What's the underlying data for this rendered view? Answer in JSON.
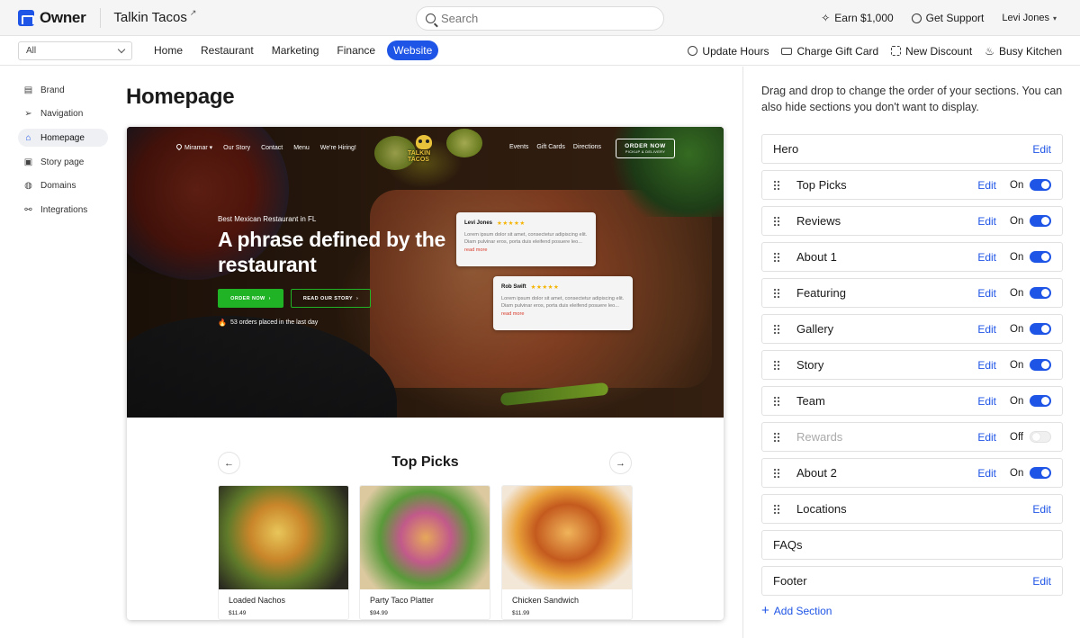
{
  "app": {
    "logo_text": "Owner",
    "restaurant": "Talkin Tacos",
    "restaurant_ext": "↗"
  },
  "search": {
    "placeholder": "Search"
  },
  "top_right": {
    "earn": "Earn $1,000",
    "support": "Get Support",
    "user": "Levi Jones"
  },
  "navbar": {
    "select_value": "All",
    "tabs": [
      {
        "label": "Home"
      },
      {
        "label": "Restaurant"
      },
      {
        "label": "Marketing"
      },
      {
        "label": "Finance"
      },
      {
        "label": "Website",
        "active": true
      }
    ],
    "actions": [
      {
        "label": "Update Hours",
        "icon": "clock-icon"
      },
      {
        "label": "Charge Gift Card",
        "icon": "card-icon"
      },
      {
        "label": "New Discount",
        "icon": "discount-icon"
      },
      {
        "label": "Busy Kitchen",
        "icon": "kitchen-icon"
      }
    ]
  },
  "sidebar": {
    "items": [
      {
        "label": "Brand",
        "icon": "brand-icon"
      },
      {
        "label": "Navigation",
        "icon": "navigation-icon"
      },
      {
        "label": "Homepage",
        "icon": "home-icon",
        "active": true
      },
      {
        "label": "Story page",
        "icon": "story-icon"
      },
      {
        "label": "Domains",
        "icon": "globe-icon"
      },
      {
        "label": "Integrations",
        "icon": "integrations-icon"
      }
    ]
  },
  "main": {
    "title": "Homepage"
  },
  "preview": {
    "site_nav_left": [
      "Miramar",
      "Our Story",
      "Contact",
      "Menu",
      "We're Hiring!"
    ],
    "site_logo": "TALKIN TACOS",
    "site_nav_right": [
      "Events",
      "Gift Cards",
      "Directions"
    ],
    "order_button": {
      "main": "ORDER NOW",
      "sub": "PICKUP & DELIVERY"
    },
    "eyebrow": "Best Mexican Restaurant in FL",
    "hero_title": "A phrase defined by the restaurant",
    "btn_order": "ORDER NOW",
    "btn_story": "READ OUR STORY",
    "orders_note": "53 orders placed in the last day",
    "reviews": [
      {
        "name": "Levi Jones",
        "stars": "★★★★★",
        "body": "Lorem ipsum dolor sit amet, consectetur adipiscing elit. Diam pulvinar eros, porta duis eleifend posuere leo...",
        "more": "read more"
      },
      {
        "name": "Rob Swift",
        "stars": "★★★★★",
        "body": "Lorem ipsum dolor sit amet, consectetur adipiscing elit. Diam pulvinar eros, porta duis eleifend posuere leo...",
        "more": "read more"
      }
    ],
    "picks_title": "Top Picks",
    "picks": [
      {
        "name": "Loaded Nachos",
        "price": "$11.49"
      },
      {
        "name": "Party Taco Platter",
        "price": "$94.99"
      },
      {
        "name": "Chicken Sandwich",
        "price": "$11.99"
      }
    ]
  },
  "panel": {
    "description": "Drag and drop  to change the order of your sections. You can also hide sections you don't want to display.",
    "edit_label": "Edit",
    "sections": [
      {
        "name": "Hero",
        "draggable": false,
        "edit": true,
        "toggle": null
      },
      {
        "name": "Top Picks",
        "draggable": true,
        "edit": true,
        "toggle": "On"
      },
      {
        "name": "Reviews",
        "draggable": true,
        "edit": true,
        "toggle": "On"
      },
      {
        "name": "About 1",
        "draggable": true,
        "edit": true,
        "toggle": "On"
      },
      {
        "name": "Featuring",
        "draggable": true,
        "edit": true,
        "toggle": "On"
      },
      {
        "name": "Gallery",
        "draggable": true,
        "edit": true,
        "toggle": "On"
      },
      {
        "name": "Story",
        "draggable": true,
        "edit": true,
        "toggle": "On"
      },
      {
        "name": "Team",
        "draggable": true,
        "edit": true,
        "toggle": "On"
      },
      {
        "name": "Rewards",
        "draggable": true,
        "edit": true,
        "toggle": "Off"
      },
      {
        "name": "About 2",
        "draggable": true,
        "edit": true,
        "toggle": "On"
      },
      {
        "name": "Locations",
        "draggable": true,
        "edit": true,
        "toggle": null
      },
      {
        "name": "FAQs",
        "draggable": false,
        "edit": false,
        "toggle": null
      },
      {
        "name": "Footer",
        "draggable": false,
        "edit": true,
        "toggle": null
      }
    ],
    "add_section": "Add Section"
  },
  "colors": {
    "accent": "#1f55e6",
    "green": "#1fb325",
    "star": "#f5b400"
  }
}
